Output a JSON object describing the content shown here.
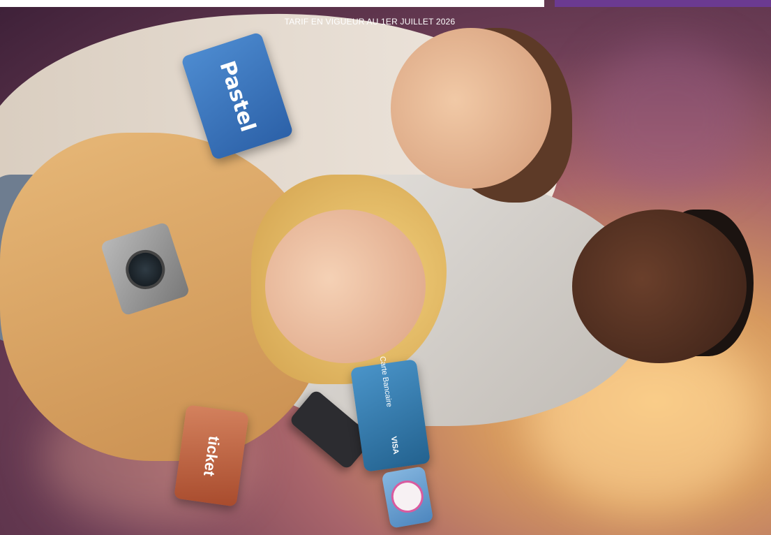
{
  "banner": {
    "tariff_notice": "TARIF EN VIGUEUR AU 1ER JUILLET 2026"
  },
  "cards": {
    "pastel_label": "Pastel",
    "ticket_label": "ticket",
    "bank_card_label": "Carte Bancaire",
    "bank_card_brand": "VISA"
  },
  "colors": {
    "accent_tab": "#6b3a91",
    "pastel_card": "#3a78c2",
    "ticket_card": "#b85a3a",
    "bank_card": "#2f79ad"
  }
}
